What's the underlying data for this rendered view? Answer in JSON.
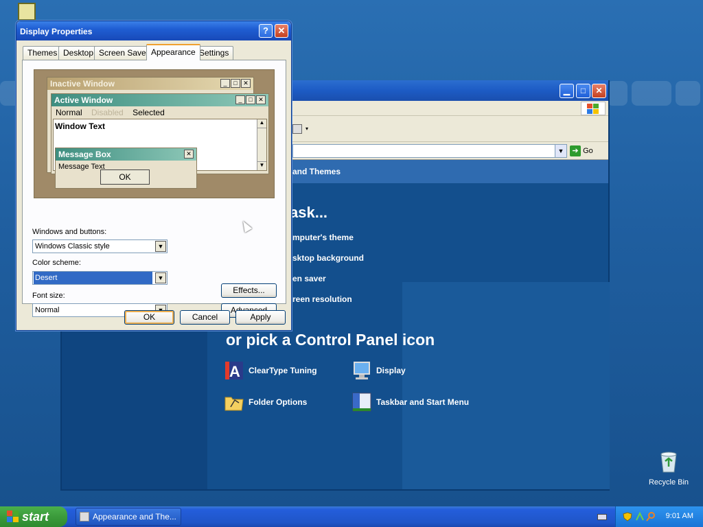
{
  "dialog": {
    "title": "Display Properties",
    "help_label": "?",
    "close_label": "✕",
    "tabs": [
      {
        "label": "Themes"
      },
      {
        "label": "Desktop"
      },
      {
        "label": "Screen Saver"
      },
      {
        "label": "Appearance",
        "active": true
      },
      {
        "label": "Settings"
      }
    ],
    "preview": {
      "inactive_title": "Inactive Window",
      "active_title": "Active Window",
      "menu_normal": "Normal",
      "menu_disabled": "Disabled",
      "menu_selected": "Selected",
      "window_text": "Window Text",
      "msgbox_title": "Message Box",
      "msgbox_text": "Message Text",
      "msgbox_ok": "OK"
    },
    "windows_buttons_label": "Windows and buttons:",
    "windows_buttons_value": "Windows Classic style",
    "color_scheme_label": "Color scheme:",
    "color_scheme_value": "Desert",
    "font_size_label": "Font size:",
    "font_size_value": "Normal",
    "effects_label": "Effects...",
    "advanced_label": "Advanced",
    "ok_label": "OK",
    "cancel_label": "Cancel",
    "apply_label": "Apply"
  },
  "control_panel": {
    "go_label": "Go",
    "category_title": "and Themes",
    "pick_task": "ask...",
    "tasks": [
      "mputer's theme",
      "sktop background",
      "en saver",
      "reen resolution"
    ],
    "pick_icon_heading": "or pick a Control Panel icon",
    "icons": [
      {
        "label": "ClearType Tuning"
      },
      {
        "label": "Display"
      },
      {
        "label": "Folder Options"
      },
      {
        "label": "Taskbar and Start Menu"
      }
    ]
  },
  "desktop": {
    "recycle_bin_label": "Recycle Bin"
  },
  "taskbar": {
    "start_label": "start",
    "task_label": "Appearance and The...",
    "clock": "9:01 AM"
  },
  "colors": {
    "desert_active_title": "#4a9a8c",
    "desert_inactive_title": "#c9b98a",
    "selection": "#316ac5",
    "xp_blue": "#245edb",
    "start_green": "#3b9b3b"
  }
}
